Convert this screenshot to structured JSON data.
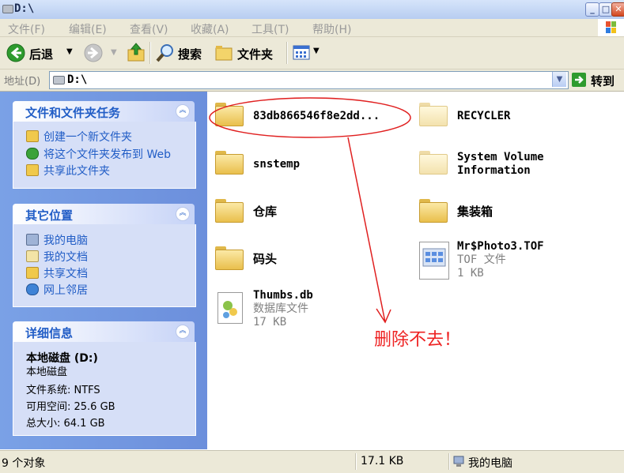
{
  "window": {
    "title": "D:\\",
    "controls": {
      "minimize": "_",
      "maximize": "□",
      "close": "✕"
    }
  },
  "menu": [
    "文件(F)",
    "编辑(E)",
    "查看(V)",
    "收藏(A)",
    "工具(T)",
    "帮助(H)"
  ],
  "toolbar": {
    "back_label": "后退",
    "search_label": "搜索",
    "folders_label": "文件夹"
  },
  "address": {
    "label": "地址(D)",
    "value": "D:\\",
    "go_label": "转到"
  },
  "left_pane": {
    "tasks": {
      "title": "文件和文件夹任务",
      "items": [
        "创建一个新文件夹",
        "将这个文件夹发布到 Web",
        "共享此文件夹"
      ]
    },
    "other_places": {
      "title": "其它位置",
      "items": [
        "我的电脑",
        "我的文档",
        "共享文档",
        "网上邻居"
      ]
    },
    "details": {
      "title": "详细信息",
      "name": "本地磁盘 (D:)",
      "type": "本地磁盘",
      "filesystem": "文件系统: NTFS",
      "free": "可用空间: 25.6 GB",
      "total": "总大小: 64.1 GB"
    }
  },
  "files": [
    {
      "name": "83db866546f8e2dd...",
      "kind": "folder"
    },
    {
      "name": "RECYCLER",
      "kind": "folder-hidden"
    },
    {
      "name": "snstemp",
      "kind": "folder"
    },
    {
      "name": "System Volume\nInformation",
      "kind": "folder-hidden"
    },
    {
      "name": "仓库",
      "kind": "folder"
    },
    {
      "name": "集装箱",
      "kind": "folder"
    },
    {
      "name": "码头",
      "kind": "folder"
    },
    {
      "name": "Mr$Photo3.TOF",
      "kind": "file",
      "type": "TOF 文件",
      "size": "1 KB"
    },
    {
      "name": "Thumbs.db",
      "kind": "file",
      "type": "数据库文件",
      "size": "17 KB"
    }
  ],
  "annotation": {
    "text": "删除不去！",
    "color": "#ee2222"
  },
  "status": {
    "count": "9 个对象",
    "size": "17.1 KB",
    "location": "我的电脑"
  },
  "colors": {
    "left_pane": "#7aa1e6",
    "link": "#215dc6",
    "folder": "#e9bf4c"
  }
}
